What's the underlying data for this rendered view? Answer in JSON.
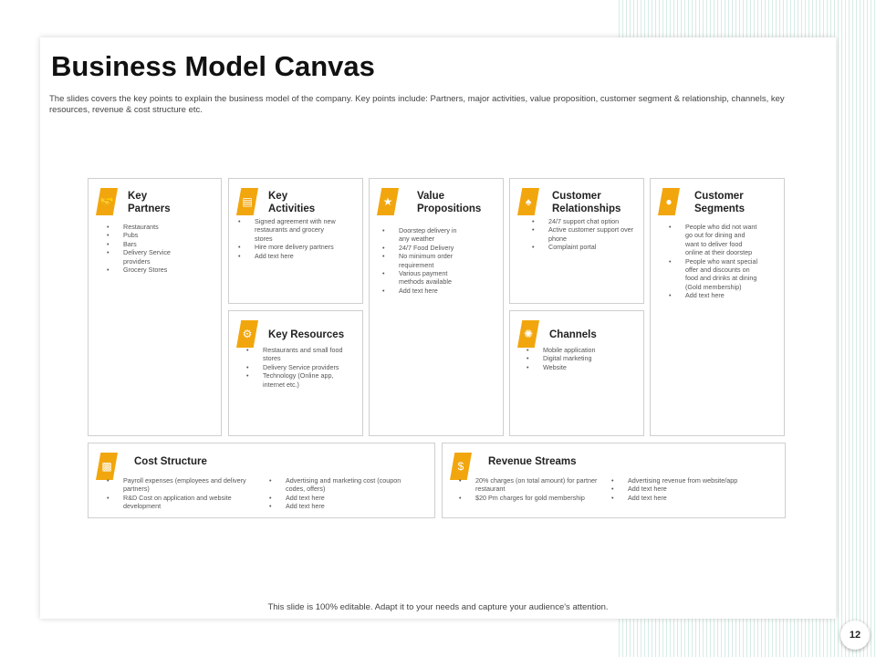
{
  "title": "Business Model Canvas",
  "description": "The slides covers the key points to explain the business model of the company. Key points include: Partners, major activities, value proposition, customer segment & relationship, channels, key resources, revenue & cost structure etc.",
  "footer": "This slide is 100% editable. Adapt it to your needs and capture your audience's attention.",
  "page_number": "12",
  "accent_color": "#F2A60D",
  "key_partners": {
    "heading": "Key Partners",
    "items": [
      "Restaurants",
      "Pubs",
      "Bars",
      "Delivery Service providers",
      "Grocery Stores"
    ]
  },
  "key_activities": {
    "heading": "Key Activities",
    "items": [
      "Signed agreement with new restaurants and grocery stores",
      "Hire more delivery partners",
      "Add text here"
    ]
  },
  "value_propositions": {
    "heading": "Value Propositions",
    "items": [
      "Doorstep delivery in any weather",
      "24/7 Food Delivery",
      "No minimum order requirement",
      "Various payment methods available",
      "Add text here"
    ]
  },
  "customer_relationships": {
    "heading": "Customer Relationships",
    "items": [
      "24/7 support chat option",
      "Active customer support over phone",
      "Complaint portal"
    ]
  },
  "customer_segments": {
    "heading": "Customer Segments",
    "items": [
      "People who did not want go out for dining and want to deliver food online at their doorstep",
      "People who want special offer and discounts on food and drinks at dining (Gold membership)",
      "Add text here"
    ]
  },
  "key_resources": {
    "heading": "Key Resources",
    "items": [
      "Restaurants and small food stores",
      "Delivery Service providers",
      "Technology (Online app, internet etc.)"
    ]
  },
  "channels": {
    "heading": "Channels",
    "items": [
      "Mobile application",
      "Digital marketing",
      "Website"
    ]
  },
  "cost_structure": {
    "heading": "Cost Structure",
    "col1": [
      "Payroll expenses (employees and delivery partners)",
      "R&D Cost on application and website development"
    ],
    "col2": [
      "Advertising and marketing cost (coupon codes, offers)",
      "Add text here",
      "Add text here"
    ]
  },
  "revenue_streams": {
    "heading": "Revenue Streams",
    "col1": [
      "20% charges (on total amount) for partner restaurant",
      "$20 Pm charges for gold membership"
    ],
    "col2": [
      "Advertising revenue from website/app",
      "Add text here",
      "Add text here"
    ]
  },
  "icons": {
    "key_partners": "handshake-icon",
    "key_activities": "clipboard-icon",
    "value_propositions": "hand-gift-icon",
    "customer_relationships": "handshake-people-icon",
    "customer_segments": "person-icon",
    "key_resources": "person-gear-icon",
    "channels": "network-icon",
    "cost_structure": "documents-icon",
    "revenue_streams": "money-icon"
  }
}
